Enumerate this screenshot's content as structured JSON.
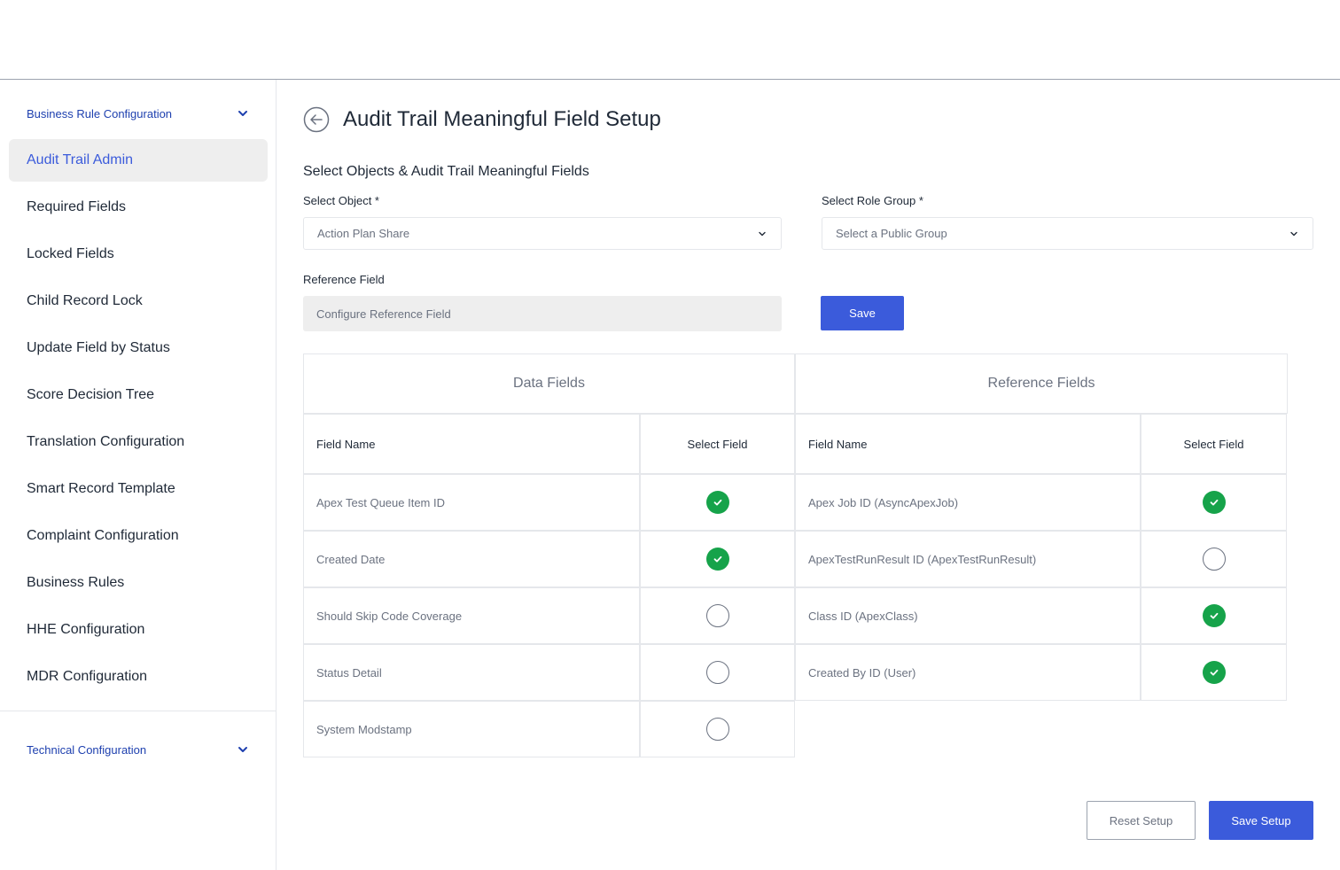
{
  "sidebar": {
    "section1": {
      "label": "Business Rule Configuration",
      "icon": "chevron-down-icon"
    },
    "items": [
      {
        "label": "Audit Trail Admin",
        "active": true
      },
      {
        "label": "Required Fields",
        "active": false
      },
      {
        "label": "Locked Fields",
        "active": false
      },
      {
        "label": "Child Record Lock",
        "active": false
      },
      {
        "label": "Update Field by Status",
        "active": false
      },
      {
        "label": "Score Decision Tree",
        "active": false
      },
      {
        "label": "Translation Configuration",
        "active": false
      },
      {
        "label": "Smart Record Template",
        "active": false
      },
      {
        "label": "Complaint Configuration",
        "active": false
      },
      {
        "label": "Business Rules",
        "active": false
      },
      {
        "label": "HHE Configuration",
        "active": false
      },
      {
        "label": "MDR Configuration",
        "active": false
      }
    ],
    "section2": {
      "label": "Technical Configuration",
      "icon": "chevron-down-icon"
    }
  },
  "page": {
    "back_icon": "arrow-left-circle-icon",
    "title": "Audit Trail Meaningful Field Setup",
    "subtitle": "Select Objects & Audit Trail Meaningful Fields"
  },
  "form": {
    "object_label": "Select Object *",
    "object_value": "Action Plan Share",
    "role_group_label": "Select Role Group *",
    "role_group_placeholder": "Select a Public Group",
    "reference_label": "Reference Field",
    "reference_placeholder": "Configure Reference Field",
    "save_label": "Save"
  },
  "data_fields": {
    "title": "Data Fields",
    "col_name": "Field Name",
    "col_select": "Select Field",
    "rows": [
      {
        "name": "Apex Test Queue Item ID",
        "selected": true
      },
      {
        "name": "Created Date",
        "selected": true
      },
      {
        "name": "Should Skip Code Coverage",
        "selected": false
      },
      {
        "name": "Status Detail",
        "selected": false
      },
      {
        "name": "System Modstamp",
        "selected": false
      }
    ]
  },
  "reference_fields": {
    "title": "Reference Fields",
    "col_name": "Field Name",
    "col_select": "Select Field",
    "rows": [
      {
        "name": "Apex Job ID (AsyncApexJob)",
        "selected": true
      },
      {
        "name": "ApexTestRunResult ID (ApexTestRunResult)",
        "selected": false
      },
      {
        "name": "Class ID (ApexClass)",
        "selected": true
      },
      {
        "name": "Created By ID (User)",
        "selected": true
      }
    ]
  },
  "footer": {
    "reset_label": "Reset Setup",
    "save_setup_label": "Save Setup"
  },
  "colors": {
    "accent": "#3b5bdb",
    "checked": "#16a34a",
    "active_nav_bg": "#eeeeee",
    "section_label": "#1e40af"
  }
}
